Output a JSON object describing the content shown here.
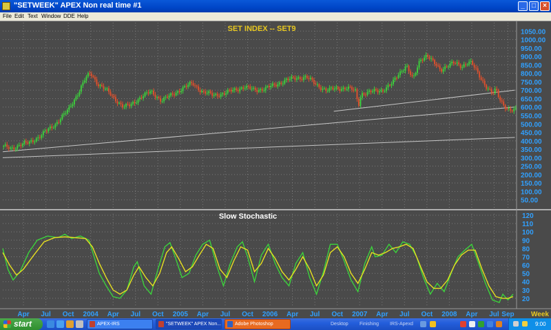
{
  "window": {
    "title": "\"SETWEEK\" APEX Non real time #1",
    "buttons": [
      "_",
      "□",
      "×"
    ]
  },
  "menu": [
    "File",
    "Edit",
    "Text",
    "Window",
    "DDE",
    "Help"
  ],
  "colors": {
    "panel_bg": "#4a4a4a",
    "grid": "#7a7a7a",
    "up_bar": "#3cd23c",
    "down_bar": "#e0502c",
    "stoch_k": "#3cd23c",
    "stoch_d": "#e8e020",
    "trendline": "#c8c8c8",
    "axis_text": "#30a0ff",
    "title_text": "#e8c820"
  },
  "chart_data": [
    {
      "type": "candlestick",
      "title": "SET  INDEX  --  SET9",
      "xlabel": "Week",
      "ylim": [
        0,
        1100
      ],
      "y_ticks": [
        "1050.00",
        "1000.00",
        "950.00",
        "900.00",
        "850.00",
        "800.00",
        "750.00",
        "700.00",
        "650.00",
        "600.00",
        "550.00",
        "500.00",
        "450.00",
        "400.00",
        "350.00",
        "300.00",
        "250.00",
        "200.00",
        "150.00",
        "100.00",
        "50.00"
      ],
      "x_ticks": [
        "Apr",
        "Jul",
        "Oct",
        "2004",
        "Apr",
        "Jul",
        "Oct",
        "2005",
        "Apr",
        "Jul",
        "Oct",
        "2006",
        "Apr",
        "Jul",
        "Oct",
        "2007",
        "Apr",
        "Jul",
        "Oct",
        "2008",
        "Apr",
        "Jul",
        "Sep"
      ],
      "x_tick_weeks": [
        12,
        25,
        38,
        51,
        64,
        77,
        90,
        103,
        116,
        129,
        142,
        155,
        168,
        181,
        194,
        207,
        220,
        233,
        246,
        259,
        272,
        285,
        293
      ],
      "total_weeks": 298,
      "price_path": [
        [
          0,
          365
        ],
        [
          5,
          356
        ],
        [
          10,
          375
        ],
        [
          15,
          388
        ],
        [
          22,
          430
        ],
        [
          30,
          495
        ],
        [
          38,
          582
        ],
        [
          44,
          690
        ],
        [
          48,
          770
        ],
        [
          51,
          800
        ],
        [
          55,
          740
        ],
        [
          60,
          700
        ],
        [
          66,
          640
        ],
        [
          70,
          600
        ],
        [
          74,
          610
        ],
        [
          80,
          660
        ],
        [
          86,
          690
        ],
        [
          92,
          640
        ],
        [
          98,
          670
        ],
        [
          104,
          710
        ],
        [
          110,
          740
        ],
        [
          116,
          690
        ],
        [
          122,
          670
        ],
        [
          128,
          680
        ],
        [
          134,
          700
        ],
        [
          140,
          720
        ],
        [
          146,
          700
        ],
        [
          152,
          710
        ],
        [
          158,
          730
        ],
        [
          164,
          760
        ],
        [
          170,
          770
        ],
        [
          176,
          780
        ],
        [
          182,
          730
        ],
        [
          188,
          700
        ],
        [
          194,
          710
        ],
        [
          200,
          715
        ],
        [
          205,
          690
        ],
        [
          206,
          600
        ],
        [
          208,
          680
        ],
        [
          214,
          690
        ],
        [
          220,
          700
        ],
        [
          226,
          740
        ],
        [
          230,
          800
        ],
        [
          234,
          850
        ],
        [
          238,
          760
        ],
        [
          242,
          880
        ],
        [
          246,
          910
        ],
        [
          250,
          860
        ],
        [
          254,
          820
        ],
        [
          258,
          850
        ],
        [
          262,
          860
        ],
        [
          266,
          840
        ],
        [
          270,
          870
        ],
        [
          272,
          860
        ],
        [
          276,
          790
        ],
        [
          280,
          730
        ],
        [
          284,
          680
        ],
        [
          286,
          700
        ],
        [
          288,
          650
        ],
        [
          290,
          620
        ],
        [
          293,
          590
        ],
        [
          295,
          580
        ]
      ],
      "trendlines": [
        {
          "from": [
            0,
            300
          ],
          "to": [
            297,
            420
          ]
        },
        {
          "from": [
            0,
            335
          ],
          "to": [
            297,
            600
          ]
        },
        {
          "from": [
            192,
            575
          ],
          "to": [
            297,
            700
          ]
        }
      ]
    },
    {
      "type": "line",
      "title": "Slow  Stochastic",
      "ylim": [
        10,
        125
      ],
      "y_ticks": [
        "120",
        "110",
        "100",
        "90",
        "80",
        "70",
        "60",
        "50",
        "40",
        "30",
        "20"
      ],
      "series": [
        {
          "key": "k",
          "values": [
            [
              0,
              80
            ],
            [
              3,
              55
            ],
            [
              6,
              42
            ],
            [
              10,
              52
            ],
            [
              15,
              75
            ],
            [
              20,
              90
            ],
            [
              26,
              95
            ],
            [
              32,
              93
            ],
            [
              36,
              97
            ],
            [
              40,
              92
            ],
            [
              45,
              95
            ],
            [
              50,
              90
            ],
            [
              53,
              70
            ],
            [
              56,
              50
            ],
            [
              60,
              35
            ],
            [
              64,
              22
            ],
            [
              68,
              20
            ],
            [
              72,
              30
            ],
            [
              76,
              58
            ],
            [
              78,
              64
            ],
            [
              82,
              35
            ],
            [
              86,
              25
            ],
            [
              90,
              55
            ],
            [
              94,
              82
            ],
            [
              97,
              87
            ],
            [
              100,
              70
            ],
            [
              104,
              45
            ],
            [
              108,
              50
            ],
            [
              112,
              72
            ],
            [
              116,
              85
            ],
            [
              120,
              90
            ],
            [
              124,
              60
            ],
            [
              128,
              35
            ],
            [
              132,
              62
            ],
            [
              136,
              82
            ],
            [
              139,
              88
            ],
            [
              142,
              70
            ],
            [
              146,
              40
            ],
            [
              150,
              72
            ],
            [
              154,
              85
            ],
            [
              158,
              62
            ],
            [
              162,
              45
            ],
            [
              166,
              35
            ],
            [
              170,
              62
            ],
            [
              174,
              75
            ],
            [
              178,
              45
            ],
            [
              182,
              25
            ],
            [
              186,
              52
            ],
            [
              190,
              85
            ],
            [
              194,
              85
            ],
            [
              198,
              65
            ],
            [
              202,
              42
            ],
            [
              206,
              28
            ],
            [
              210,
              62
            ],
            [
              214,
              82
            ],
            [
              216,
              70
            ],
            [
              220,
              72
            ],
            [
              224,
              85
            ],
            [
              228,
              75
            ],
            [
              232,
              88
            ],
            [
              236,
              85
            ],
            [
              240,
              70
            ],
            [
              244,
              45
            ],
            [
              248,
              25
            ],
            [
              252,
              38
            ],
            [
              256,
              28
            ],
            [
              260,
              50
            ],
            [
              264,
              70
            ],
            [
              268,
              78
            ],
            [
              272,
              85
            ],
            [
              276,
              62
            ],
            [
              280,
              38
            ],
            [
              284,
              18
            ],
            [
              288,
              15
            ],
            [
              290,
              25
            ],
            [
              293,
              18
            ],
            [
              296,
              25
            ]
          ]
        },
        {
          "key": "d",
          "values": [
            [
              0,
              75
            ],
            [
              4,
              60
            ],
            [
              8,
              48
            ],
            [
              12,
              55
            ],
            [
              18,
              72
            ],
            [
              24,
              88
            ],
            [
              30,
              93
            ],
            [
              36,
              94
            ],
            [
              42,
              93
            ],
            [
              48,
              92
            ],
            [
              52,
              82
            ],
            [
              56,
              62
            ],
            [
              60,
              45
            ],
            [
              64,
              30
            ],
            [
              68,
              25
            ],
            [
              72,
              30
            ],
            [
              76,
              48
            ],
            [
              79,
              58
            ],
            [
              83,
              45
            ],
            [
              87,
              35
            ],
            [
              91,
              50
            ],
            [
              95,
              75
            ],
            [
              98,
              82
            ],
            [
              102,
              68
            ],
            [
              106,
              52
            ],
            [
              110,
              58
            ],
            [
              114,
              72
            ],
            [
              118,
              85
            ],
            [
              122,
              80
            ],
            [
              126,
              55
            ],
            [
              130,
              45
            ],
            [
              134,
              65
            ],
            [
              138,
              82
            ],
            [
              142,
              78
            ],
            [
              146,
              52
            ],
            [
              150,
              62
            ],
            [
              154,
              80
            ],
            [
              158,
              68
            ],
            [
              162,
              52
            ],
            [
              166,
              42
            ],
            [
              170,
              55
            ],
            [
              174,
              70
            ],
            [
              178,
              55
            ],
            [
              182,
              35
            ],
            [
              186,
              48
            ],
            [
              190,
              75
            ],
            [
              194,
              82
            ],
            [
              198,
              70
            ],
            [
              202,
              50
            ],
            [
              206,
              38
            ],
            [
              210,
              55
            ],
            [
              214,
              75
            ],
            [
              218,
              72
            ],
            [
              222,
              75
            ],
            [
              226,
              80
            ],
            [
              230,
              82
            ],
            [
              234,
              85
            ],
            [
              238,
              80
            ],
            [
              242,
              60
            ],
            [
              246,
              40
            ],
            [
              250,
              32
            ],
            [
              254,
              32
            ],
            [
              258,
              42
            ],
            [
              262,
              60
            ],
            [
              266,
              72
            ],
            [
              270,
              78
            ],
            [
              274,
              78
            ],
            [
              278,
              55
            ],
            [
              282,
              35
            ],
            [
              286,
              22
            ],
            [
              290,
              20
            ],
            [
              293,
              20
            ],
            [
              296,
              22
            ]
          ]
        }
      ]
    }
  ],
  "taskbar": {
    "start_label": "start",
    "tasks": [
      "APEX-IRS",
      "\"SETWEEK\" APEX Non...",
      "Adobe Photoshop"
    ],
    "tray_labels": [
      "Desktop",
      "Finishing",
      "IRS-Apexd"
    ],
    "clock": "9:00"
  }
}
